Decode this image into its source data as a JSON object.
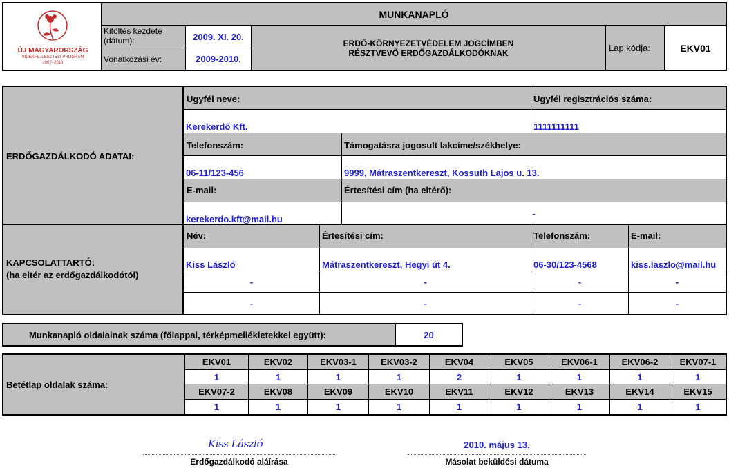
{
  "header": {
    "title": "MUNKANAPLÓ",
    "logo_lines": [
      "ÚJ MAGYARORSZÁG",
      "VIDÉKFEJLESZTÉSI PROGRAM",
      "2007–2013"
    ],
    "fill_start_label": "Kitöltés kezdete (dátum):",
    "fill_start_value": "2009. XI. 20.",
    "ref_year_label": "Vonatkozási év:",
    "ref_year_value": "2009-2010.",
    "subtitle_line1": "ERDŐ-KÖRNYEZETVÉDELEM JOGCÍMBEN",
    "subtitle_line2": "RÉSZTVEVŐ ERDŐGAZDÁLKODÓKNAK",
    "sheet_code_label": "Lap kódja:",
    "sheet_code_value": "EKV01"
  },
  "forester": {
    "section_label": "ERDŐGAZDÁLKODÓ ADATAI:",
    "client_name_label": "Ügyfél neve:",
    "client_name_value": "Kerekerdő Kft.",
    "client_reg_label": "Ügyfél regisztrációs száma:",
    "client_reg_value": "1111111111",
    "phone_label": "Telefonszám:",
    "phone_value": "06-11/123-456",
    "address_label": "Támogatásra jogosult lakcíme/székhelye:",
    "address_value": "9999, Mátraszentkereszt, Kossuth Lajos u. 13.",
    "email_label": "E-mail:",
    "email_value": "kerekerdo.kft@mail.hu",
    "notice_label": "Értesítési cím (ha eltérő):",
    "notice_value": "-"
  },
  "contact": {
    "section_label_1": "KAPCSOLATTARTÓ:",
    "section_label_2": "(ha eltér az erdőgazdálkodótól)",
    "headers": [
      "Név:",
      "Értesítési cím:",
      "Telefonszám:",
      "E-mail:"
    ],
    "rows": [
      [
        "Kiss László",
        "Mátraszentkereszt, Hegyi út 4.",
        "06-30/123-4568",
        "kiss.laszlo@mail.hu"
      ],
      [
        "-",
        "-",
        "-",
        "-"
      ],
      [
        "-",
        "-",
        "-",
        "-"
      ]
    ]
  },
  "pages": {
    "label": "Munkanapló oldalainak száma (főlappal, térképmellékletekkel együtt):",
    "value": "20"
  },
  "insert_pages": {
    "label": "Betétlap oldalak száma:",
    "row1_codes": [
      "EKV01",
      "EKV02",
      "EKV03-1",
      "EKV03-2",
      "EKV04",
      "EKV05",
      "EKV06-1",
      "EKV06-2",
      "EKV07-1"
    ],
    "row1_values": [
      "1",
      "1",
      "1",
      "1",
      "2",
      "1",
      "1",
      "1",
      "1"
    ],
    "row2_codes": [
      "EKV07-2",
      "EKV08",
      "EKV09",
      "EKV10",
      "EKV11",
      "EKV12",
      "EKV13",
      "EKV14",
      "EKV15"
    ],
    "row2_values": [
      "1",
      "1",
      "1",
      "1",
      "1",
      "1",
      "1",
      "1",
      "1"
    ]
  },
  "signature": {
    "signed_name": "Kiss László",
    "signer_caption": "Erdőgazdálkodó aláírása",
    "copy_date": "2010. május 13.",
    "copy_date_caption": "Másolat beküldési dátuma"
  }
}
